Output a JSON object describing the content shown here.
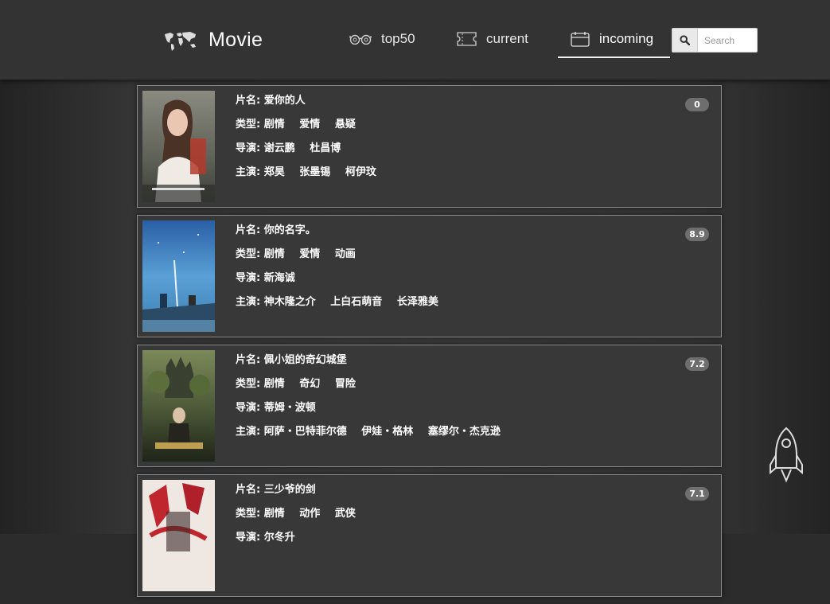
{
  "header": {
    "brand": "Movie",
    "nav": [
      {
        "label": "top50",
        "icon": "glasses-icon"
      },
      {
        "label": "current",
        "icon": "ticket-icon"
      },
      {
        "label": "incoming",
        "icon": "calendar-icon",
        "active": true
      }
    ],
    "search": {
      "placeholder": "Search",
      "value": ""
    }
  },
  "labels": {
    "name": "片名:",
    "genre": "类型:",
    "director": "导演:",
    "cast": "主演:"
  },
  "movies": [
    {
      "name": "爱你的人",
      "genres": [
        "剧情",
        "爱情",
        "悬疑"
      ],
      "directors": [
        "谢云鹏",
        "杜昌博"
      ],
      "cast": [
        "郑昊",
        "张墨锡",
        "柯伊玟"
      ],
      "score": "0"
    },
    {
      "name": "你的名字。",
      "genres": [
        "剧情",
        "爱情",
        "动画"
      ],
      "directors": [
        "新海诚"
      ],
      "cast": [
        "神木隆之介",
        "上白石萌音",
        "长泽雅美"
      ],
      "score": "8.9"
    },
    {
      "name": "佩小姐的奇幻城堡",
      "genres": [
        "剧情",
        "奇幻",
        "冒险"
      ],
      "directors": [
        "蒂姆・波顿"
      ],
      "cast": [
        "阿萨・巴特菲尔德",
        "伊娃・格林",
        "塞缪尔・杰克逊"
      ],
      "score": "7.2"
    },
    {
      "name": "三少爷的剑",
      "genres": [
        "剧情",
        "动作",
        "武侠"
      ],
      "directors": [
        "尔冬升"
      ],
      "cast": [],
      "score": "7.1"
    }
  ],
  "colors": {
    "header": "#333333",
    "background": "#3a3a3a",
    "card": "#383838",
    "badge": "#6e6e6e"
  }
}
